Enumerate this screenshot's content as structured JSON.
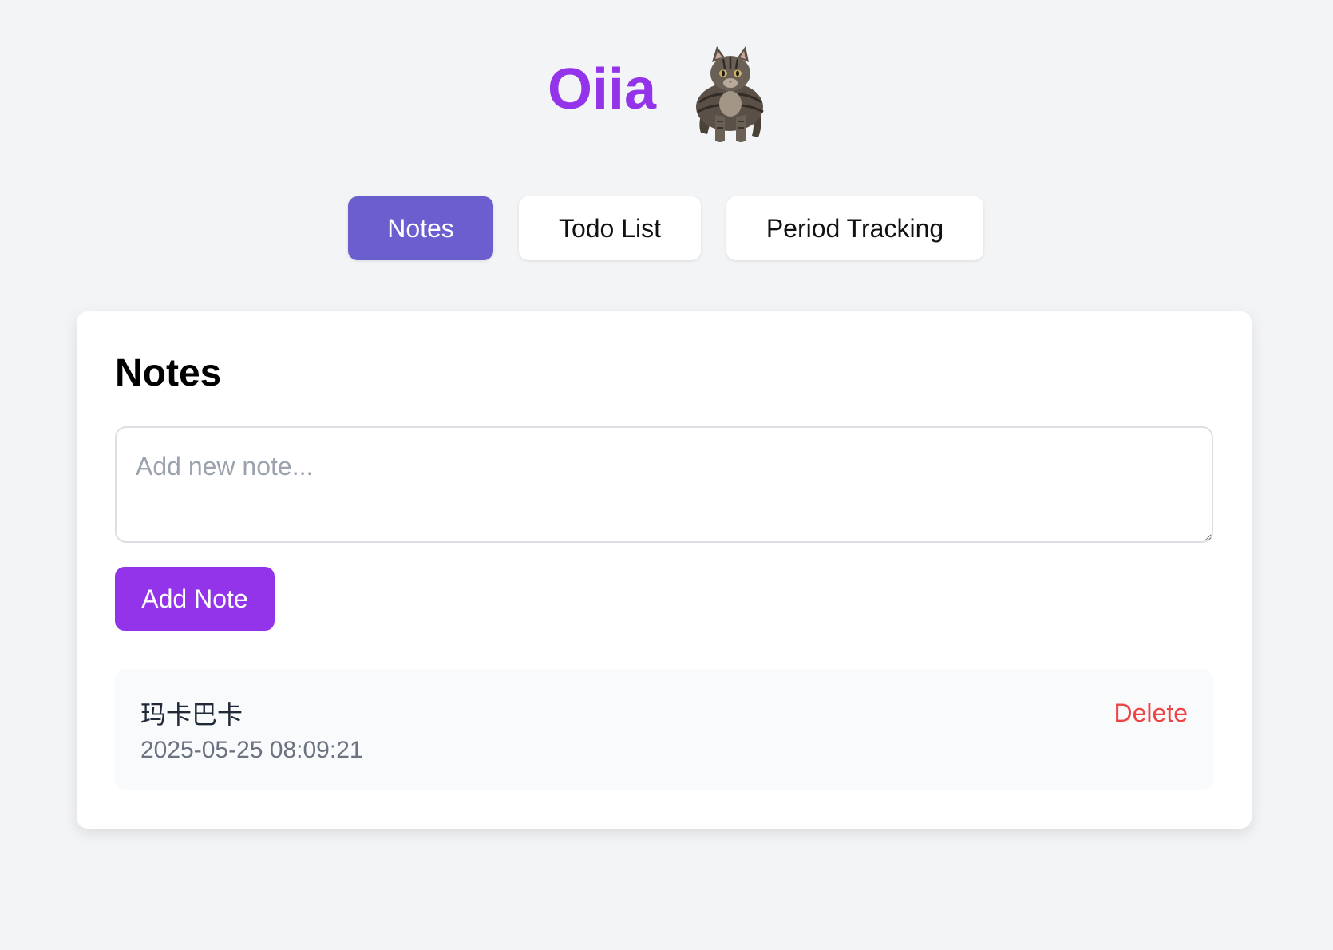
{
  "app": {
    "title": "Oiia",
    "title_color": "#9333ea",
    "mascot_icon": "cat-icon"
  },
  "tabs": [
    {
      "label": "Notes",
      "active": true
    },
    {
      "label": "Todo List",
      "active": false
    },
    {
      "label": "Period Tracking",
      "active": false
    }
  ],
  "notes_section": {
    "title": "Notes",
    "input": {
      "placeholder": "Add new note...",
      "value": ""
    },
    "add_button_label": "Add Note",
    "items": [
      {
        "content": "玛卡巴卡",
        "timestamp": "2025-05-25 08:09:21",
        "delete_label": "Delete"
      }
    ]
  },
  "colors": {
    "background": "#f3f4f6",
    "active_tab": "#6b5fcf",
    "primary_button": "#9333ea",
    "delete": "#ef4444"
  }
}
